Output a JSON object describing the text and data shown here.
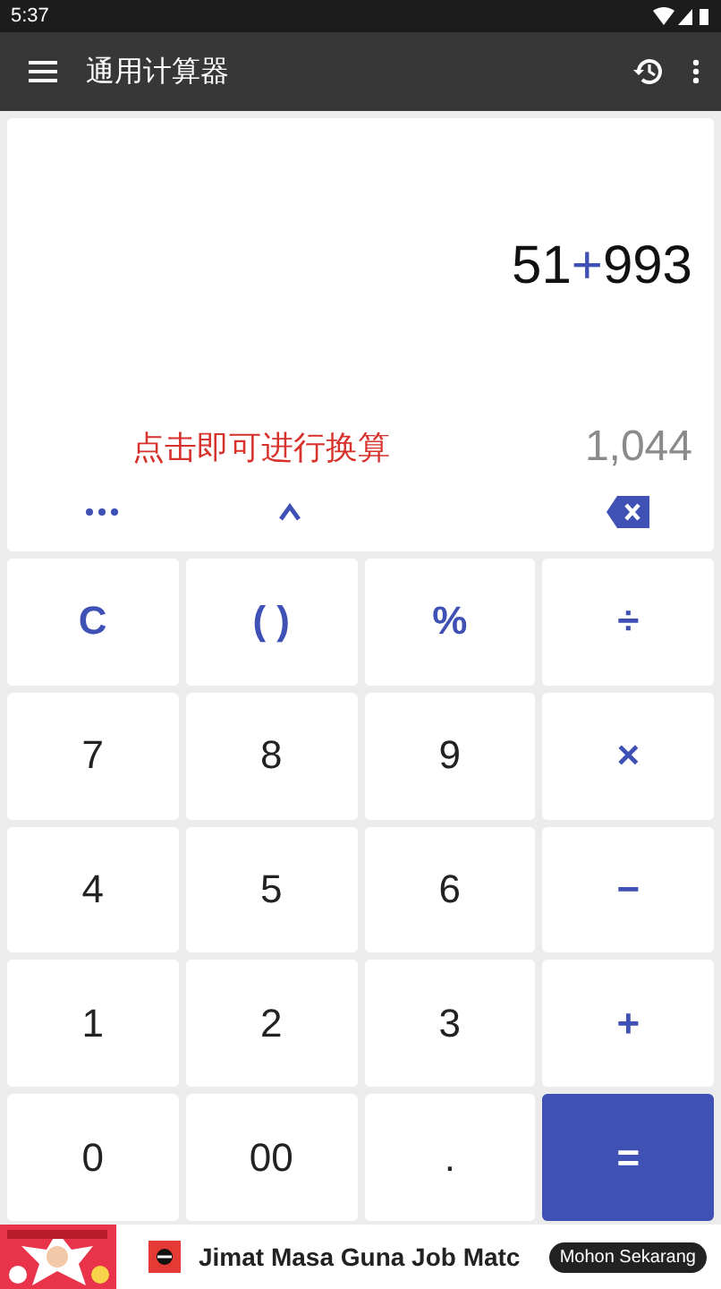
{
  "status_bar": {
    "time": "5:37"
  },
  "app_bar": {
    "title": "通用计算器"
  },
  "display": {
    "expression": [
      {
        "text": "51",
        "kind": "number"
      },
      {
        "text": "+",
        "kind": "operator"
      },
      {
        "text": "993",
        "kind": "number"
      }
    ],
    "hint": "点击即可进行换算",
    "result": "1,044"
  },
  "keypad": [
    {
      "label": "C",
      "kind": "operator"
    },
    {
      "label": "( )",
      "kind": "operator"
    },
    {
      "label": "%",
      "kind": "operator"
    },
    {
      "label": "÷",
      "kind": "operator"
    },
    {
      "label": "7",
      "kind": "digit"
    },
    {
      "label": "8",
      "kind": "digit"
    },
    {
      "label": "9",
      "kind": "digit"
    },
    {
      "label": "×",
      "kind": "operator"
    },
    {
      "label": "4",
      "kind": "digit"
    },
    {
      "label": "5",
      "kind": "digit"
    },
    {
      "label": "6",
      "kind": "digit"
    },
    {
      "label": "−",
      "kind": "operator"
    },
    {
      "label": "1",
      "kind": "digit"
    },
    {
      "label": "2",
      "kind": "digit"
    },
    {
      "label": "3",
      "kind": "digit"
    },
    {
      "label": "+",
      "kind": "operator"
    },
    {
      "label": "0",
      "kind": "digit"
    },
    {
      "label": "00",
      "kind": "digit"
    },
    {
      "label": ".",
      "kind": "digit"
    },
    {
      "label": "=",
      "kind": "equals"
    }
  ],
  "ad": {
    "title": "Jimat Masa Guna Job Matc",
    "button": "Mohon Sekarang"
  }
}
